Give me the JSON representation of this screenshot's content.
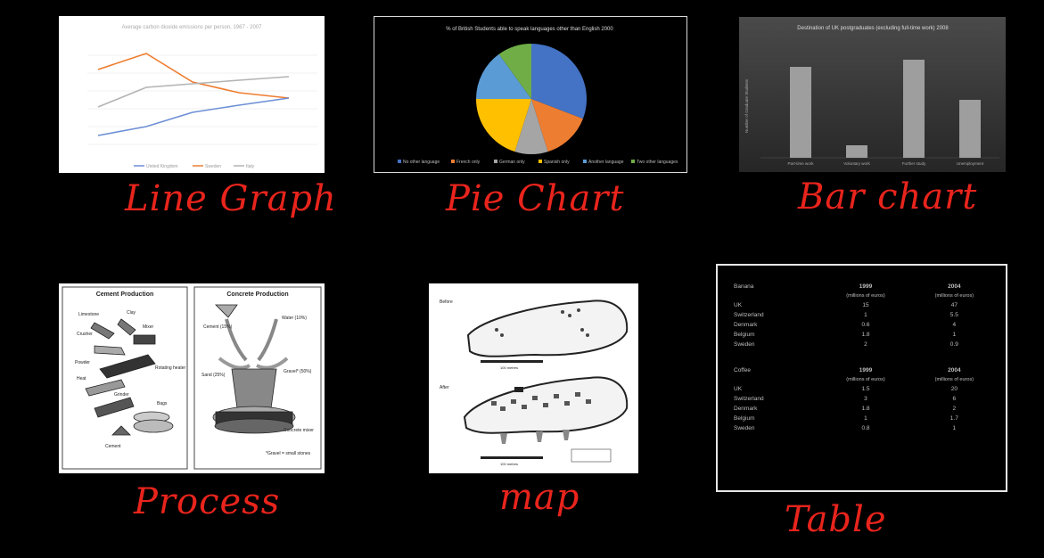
{
  "labels": {
    "line": "Line Graph",
    "pie": "Pie Chart",
    "bar": "Bar chart",
    "process": "Process",
    "map": "map",
    "table": "Table"
  },
  "colors": {
    "background": "#000000",
    "handwriting": "#e8241c",
    "line_orange": "#ed7d31",
    "line_blue": "#4472c4",
    "line_gray": "#a5a5a5",
    "pie_blue": "#4472c4",
    "pie_orange": "#ed7d31",
    "pie_gray": "#a5a5a5",
    "pie_yellow": "#ffc000",
    "pie_lightblue": "#5b9bd5",
    "pie_green": "#70ad47"
  },
  "line_chart": {
    "title": "Average carbon dioxide emissions per person, 1967 - 2007",
    "legend": [
      "United Kingdom",
      "Sweden",
      "Italy"
    ]
  },
  "pie_chart": {
    "title": "% of British Students able to speak languages other than English 2000",
    "legend": [
      "No other language",
      "French only",
      "German only",
      "Spanish only",
      "Another language",
      "Two other languages"
    ]
  },
  "bar_chart": {
    "title": "Destination of UK postgraduates (excluding full-time work) 2008",
    "ylabel": "Number of Graduate Students",
    "categories": [
      "Part-time work",
      "Voluntary work",
      "Further study",
      "Unemployment"
    ]
  },
  "process": {
    "left_title": "Cement Production",
    "right_title": "Concrete Production",
    "left_labels": [
      "Limestone",
      "Clay",
      "Crusher",
      "Mixer",
      "Powder",
      "Rotating heater",
      "Heat",
      "Grinder",
      "Bags",
      "Cement"
    ],
    "right_labels": [
      "Cement (15%)",
      "Water (10%)",
      "Sand (25%)",
      "Gravel* (50%)",
      "Concrete mixer"
    ],
    "note": "*Gravel = small stones"
  },
  "map": {
    "before_label": "Before",
    "after_label": "After",
    "scale": "100 metres"
  },
  "table": {
    "banana": {
      "label": "Banana",
      "col1": "1999",
      "col2": "2004",
      "unit": "(millions of euros)",
      "rows": [
        {
          "country": "UK",
          "v1": "15",
          "v2": "47"
        },
        {
          "country": "Switzerland",
          "v1": "1",
          "v2": "5.5"
        },
        {
          "country": "Denmark",
          "v1": "0.6",
          "v2": "4"
        },
        {
          "country": "Belgium",
          "v1": "1.8",
          "v2": "1"
        },
        {
          "country": "Sweden",
          "v1": "2",
          "v2": "0.9"
        }
      ]
    },
    "coffee": {
      "label": "Coffee",
      "col1": "1999",
      "col2": "2004",
      "unit": "(millions of euros)",
      "rows": [
        {
          "country": "UK",
          "v1": "1.5",
          "v2": "20"
        },
        {
          "country": "Switzerland",
          "v1": "3",
          "v2": "6"
        },
        {
          "country": "Denmark",
          "v1": "1.8",
          "v2": "2"
        },
        {
          "country": "Belgium",
          "v1": "1",
          "v2": "1.7"
        },
        {
          "country": "Sweden",
          "v1": "0.8",
          "v2": "1"
        }
      ]
    }
  }
}
